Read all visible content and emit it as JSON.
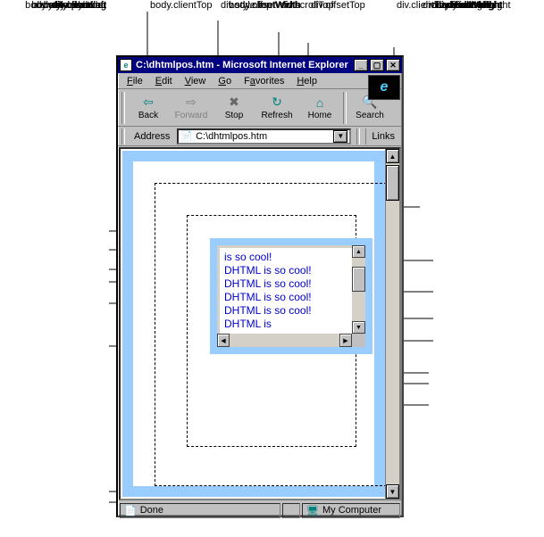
{
  "window": {
    "title": "C:\\dhtmlpos.htm - Microsoft Internet Explorer",
    "min": "_",
    "max": "▢",
    "close": "✕"
  },
  "menu": {
    "file": "File",
    "edit": "Edit",
    "view": "View",
    "go": "Go",
    "favorites": "Favorites",
    "help": "Help"
  },
  "toolbar": {
    "back": "Back",
    "forward": "Forward",
    "stop": "Stop",
    "refresh": "Refresh",
    "home": "Home",
    "search": "Search"
  },
  "address": {
    "label": "Address",
    "value": "C:\\dhtmlpos.htm",
    "links": "Links"
  },
  "content": {
    "text": "is so cool!\nDHTML is so cool! DHTML is so cool! DHTML is so cool! DHTML is so cool! DHTML is"
  },
  "status": {
    "done": "Done",
    "zone": "My Computer"
  },
  "callouts": {
    "body_clientTop": "body.clientTop",
    "div_style_top": "div.style.top",
    "div_scrollTop": "div.scrollTop",
    "div_offsetTop": "div.offsetTop",
    "div_clientTop": "div.clientTop",
    "div_style_margin": "div.style.margin",
    "div_clientLeft": "div.clientLeft",
    "div_offsetLeft": "div.offsetLeft",
    "body_clientLeft": "body.clientLeft",
    "div_style_left": "div.style.left",
    "div_style_padding": "div.style.padding",
    "div_style_border": "div.style.border",
    "div_scrollHeight": "div.scrollHeight",
    "div_offsetHeight": "div.offsetHeight",
    "div_clientHeight": "div.clientHeight",
    "body_clientHeight": "body.clientHeight",
    "div_clientWidth": "div.clientWidth",
    "div_scrollWidth": "div.scrollWidth",
    "div_offsetWidth": "div.offsetWidth",
    "body_clientWidth": "body.clientWidth",
    "body_offsetWidth": "body.offsetWidth",
    "body_style_padding": "body.style.padding",
    "body_style_border": "body.style.border"
  },
  "logo": "e"
}
